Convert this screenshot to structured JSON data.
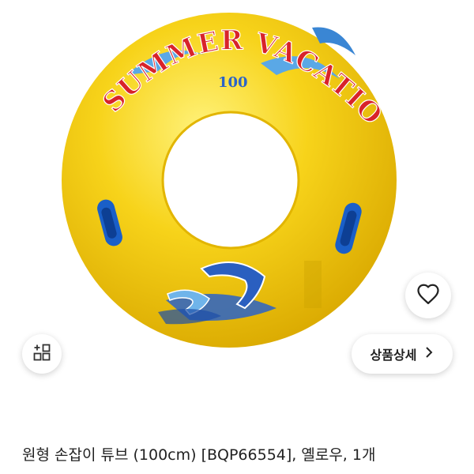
{
  "product": {
    "image_text_top": "SUMMER VACATION",
    "image_text_size": "100",
    "title": "원형 손잡이 튜브 (100cm) [BQP66554], 옐로우, 1개"
  },
  "actions": {
    "wishlist_icon": "heart-outline-icon",
    "category_icon": "grid-plus-icon",
    "detail_label": "상품상세",
    "detail_icon": "chevron-right-icon"
  },
  "colors": {
    "tube_yellow": "#f7d31a",
    "tube_shadow": "#e6b800",
    "handle_blue": "#1a5fc8",
    "banner_red": "#d8232a",
    "banner_blue": "#2a63c8",
    "text_dark": "#222222"
  }
}
